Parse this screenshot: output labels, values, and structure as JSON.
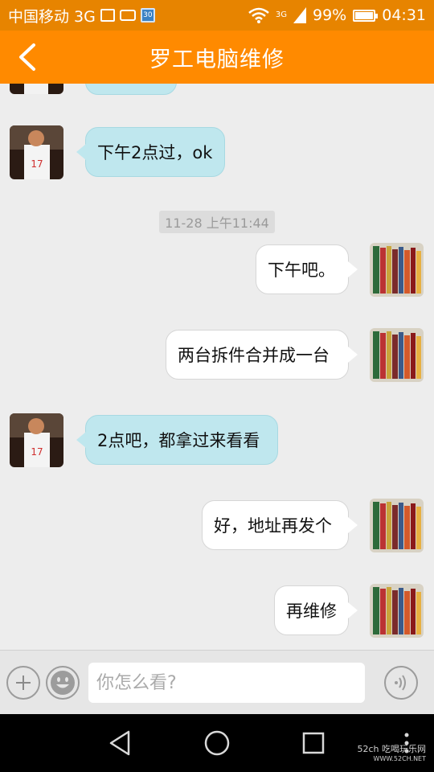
{
  "status_bar": {
    "carrier": "中国移动 3G",
    "network": "3G",
    "battery": "99%",
    "battery_level": 0.99,
    "time": "04:31",
    "calendar_day": "30"
  },
  "header": {
    "title": "罗工电脑维修"
  },
  "chat": {
    "timestamp": "11-28 上午11:44",
    "messages": [
      {
        "side": "in",
        "text": ""
      },
      {
        "side": "in",
        "text": "下午2点过，ok"
      },
      {
        "side": "out",
        "text": "下午吧。"
      },
      {
        "side": "out",
        "text": "两台拆件合并成一台"
      },
      {
        "side": "in",
        "text": "2点吧，都拿过来看看"
      },
      {
        "side": "out",
        "text": "好，地址再发个"
      },
      {
        "side": "out",
        "text": "再维修"
      }
    ]
  },
  "input": {
    "placeholder": "你怎么看?"
  },
  "watermark": {
    "line1": "52ch 吃喝玩乐网",
    "line2": "WWW.52CH.NET"
  }
}
